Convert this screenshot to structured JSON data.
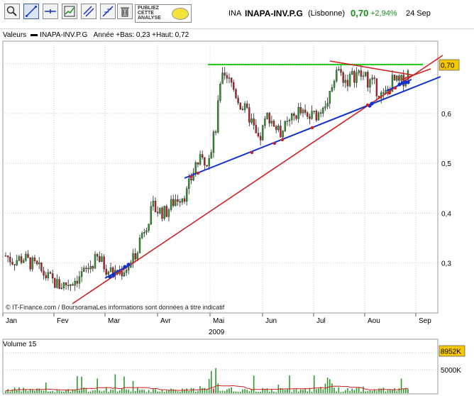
{
  "toolbar": {
    "buttons": [
      {
        "name": "zoom-tool-icon"
      },
      {
        "name": "trendline-tool-icon"
      },
      {
        "name": "horizontal-line-tool-icon"
      },
      {
        "name": "indicator-tool-icon"
      },
      {
        "name": "channel-tool-icon"
      },
      {
        "name": "fibonacci-tool-icon"
      },
      {
        "name": "trash-icon"
      }
    ],
    "ad": {
      "line1": "PUBLIEZ",
      "line2": "CETTE",
      "line3": "ANALYSE"
    }
  },
  "header": {
    "code": "INA",
    "name": "INAPA-INV.P.G",
    "market": "(Lisbonne)",
    "price": "0,70",
    "change": "+2,94%",
    "date": "24 Sep"
  },
  "legend": {
    "prefix": "Valeurs",
    "series": "INAPA-INV.P.G",
    "stats": "Année +Bas: 0,23 +Haut: 0,72"
  },
  "volume_title": "Volume 15",
  "colors": {
    "up": "#2e9a2e",
    "down": "#c42020",
    "support": "#1030d0",
    "trend": "#d02020",
    "resistance": "#22cc22",
    "tag": "#f5c800",
    "grid": "#c8c8c8"
  },
  "chart_data": [
    {
      "type": "candlestick",
      "title": "INAPA-INV.P.G",
      "xlabel": "2009",
      "x_ticks": [
        "Jan",
        "Fev",
        "Mar",
        "Avr",
        "Mai",
        "Jun",
        "Jul",
        "Aou",
        "Sep"
      ],
      "y_ticks": [
        "0,3",
        "0,4",
        "0,5",
        "0,6",
        "0,7"
      ],
      "y_tick_values": [
        0.3,
        0.4,
        0.5,
        0.6,
        0.7
      ],
      "ylim": [
        0.2,
        0.745
      ],
      "grid": true,
      "last_price_label": "0,70",
      "last_price_value": 0.7,
      "resistance_level": 0.7,
      "source_text": "© IT-Finance.com / BoursoramaLes informations sont données à titre indicatif",
      "monthly_closes": [
        {
          "month": "Jan",
          "value": 0.31
        },
        {
          "month": "Fev",
          "value": 0.26
        },
        {
          "month": "Mar",
          "value": 0.29
        },
        {
          "month": "Avr",
          "value": 0.39
        },
        {
          "month": "Mai",
          "value": 0.66
        },
        {
          "month": "Jun",
          "value": 0.56
        },
        {
          "month": "Jul",
          "value": 0.59
        },
        {
          "month": "Aou",
          "value": 0.64
        },
        {
          "month": "Sep",
          "value": 0.7
        }
      ]
    },
    {
      "type": "bar",
      "title": "Volume 15",
      "y_ticks": [
        "8952K",
        "5000K"
      ],
      "y_tick_values": [
        8952,
        5000
      ],
      "last_volume": "8952K",
      "unit": "K"
    }
  ]
}
